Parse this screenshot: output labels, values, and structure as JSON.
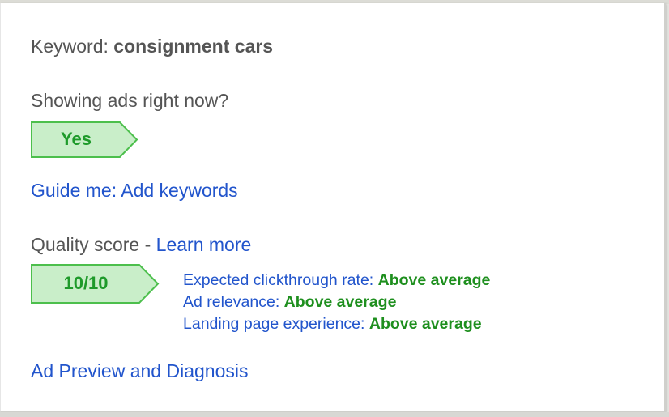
{
  "keyword": {
    "label": "Keyword:",
    "value": "consignment cars"
  },
  "showing_ads": {
    "question": "Showing ads right now?",
    "status": "Yes"
  },
  "guide_link": "Guide me: Add keywords",
  "quality_score": {
    "label": "Quality score -",
    "learn_more": "Learn more",
    "score": "10/10",
    "details": [
      {
        "label": "Expected clickthrough rate:",
        "value": "Above average"
      },
      {
        "label": "Ad relevance:",
        "value": "Above average"
      },
      {
        "label": "Landing page experience:",
        "value": "Above average"
      }
    ]
  },
  "ad_preview_link": "Ad Preview and Diagnosis",
  "colors": {
    "link": "#2255cc",
    "positive": "#1e8f1e",
    "badge_fill": "#c9eec9",
    "badge_border": "#4cbf4c",
    "text": "#555555"
  }
}
